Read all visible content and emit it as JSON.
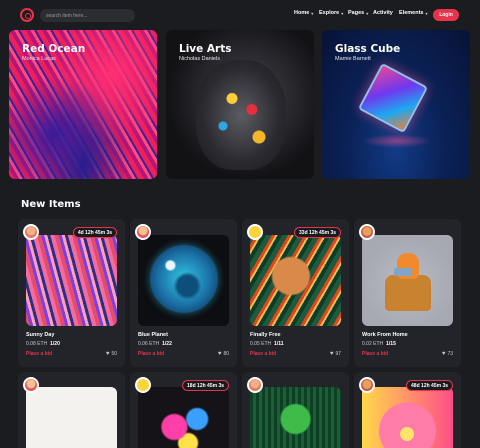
{
  "header": {
    "search_placeholder": "search item here...",
    "nav": [
      {
        "label": "Home",
        "has_dropdown": true
      },
      {
        "label": "Explore",
        "has_dropdown": true
      },
      {
        "label": "Pages",
        "has_dropdown": true
      },
      {
        "label": "Activity",
        "has_dropdown": false
      },
      {
        "label": "Elements",
        "has_dropdown": true
      }
    ],
    "login_label": "Login",
    "accent_color": "#e5344b"
  },
  "hero": [
    {
      "title": "Red Ocean",
      "author": "Monica Lucas"
    },
    {
      "title": "Live Arts",
      "author": "Nicholas Daniels"
    },
    {
      "title": "Glass Cube",
      "author": "Mamie Barnett"
    }
  ],
  "section_title": "New Items",
  "items": [
    {
      "timer": "4d 12h 45m 3s",
      "title": "Sunny Day",
      "price": "0.08 ETH",
      "qty": "1/20",
      "bid_label": "Place a bid",
      "likes": "50"
    },
    {
      "timer": "",
      "title": "Blue Planet",
      "price": "0.06 ETH",
      "qty": "1/22",
      "bid_label": "Place a bid",
      "likes": "80"
    },
    {
      "timer": "33d 12h 45m 3s",
      "title": "Finally Free",
      "price": "0.05 ETH",
      "qty": "1/11",
      "bid_label": "Place a bid",
      "likes": "97"
    },
    {
      "timer": "",
      "title": "Work From Home",
      "price": "0.02 ETH",
      "qty": "1/15",
      "bid_label": "Place a bid",
      "likes": "73"
    },
    {
      "timer": "",
      "title": "",
      "price": "",
      "qty": "",
      "bid_label": "",
      "likes": ""
    },
    {
      "timer": "18d 12h 45m 3s",
      "title": "",
      "price": "",
      "qty": "",
      "bid_label": "",
      "likes": ""
    },
    {
      "timer": "",
      "title": "",
      "price": "",
      "qty": "",
      "bid_label": "",
      "likes": ""
    },
    {
      "timer": "48d 12h 45m 3s",
      "title": "",
      "price": "",
      "qty": "",
      "bid_label": "",
      "likes": ""
    }
  ]
}
